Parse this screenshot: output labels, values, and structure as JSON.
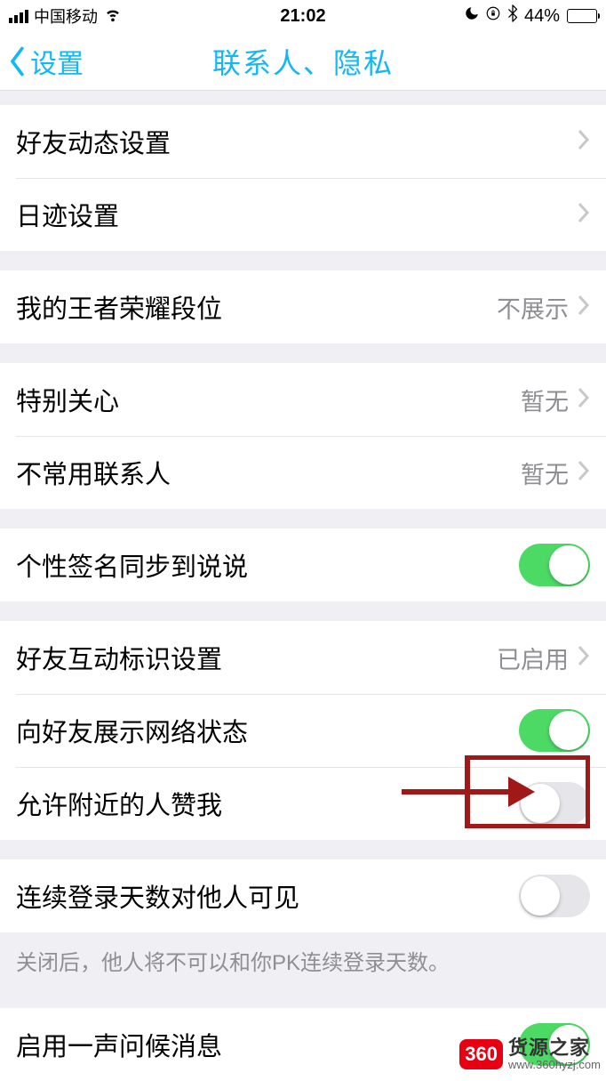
{
  "status": {
    "carrier": "中国移动",
    "time": "21:02",
    "battery_pct": "44%"
  },
  "nav": {
    "back_label": "设置",
    "title": "联系人、隐私"
  },
  "groups": [
    {
      "cells": [
        {
          "id": "friend-moments-settings",
          "label": "好友动态设置",
          "type": "chevron"
        },
        {
          "id": "riji-settings",
          "label": "日迹设置",
          "type": "chevron"
        }
      ]
    },
    {
      "cells": [
        {
          "id": "wangzhe-rank",
          "label": "我的王者荣耀段位",
          "value": "不展示",
          "type": "chevron"
        }
      ]
    },
    {
      "cells": [
        {
          "id": "special-care",
          "label": "特别关心",
          "value": "暂无",
          "type": "chevron"
        },
        {
          "id": "infrequent-contacts",
          "label": "不常用联系人",
          "value": "暂无",
          "type": "chevron"
        }
      ]
    },
    {
      "cells": [
        {
          "id": "signature-sync",
          "label": "个性签名同步到说说",
          "type": "switch",
          "on": true
        }
      ]
    },
    {
      "cells": [
        {
          "id": "friend-interaction-badge",
          "label": "好友互动标识设置",
          "value": "已启用",
          "type": "chevron"
        },
        {
          "id": "show-network-status",
          "label": "向好友展示网络状态",
          "type": "switch",
          "on": true
        },
        {
          "id": "nearby-like-me",
          "label": "允许附近的人赞我",
          "type": "switch",
          "on": false
        }
      ]
    },
    {
      "cells": [
        {
          "id": "login-days-visible",
          "label": "连续登录天数对他人可见",
          "type": "switch",
          "on": false
        }
      ],
      "footer": "关闭后，他人将不可以和你PK连续登录天数。"
    },
    {
      "cells": [
        {
          "id": "greeting-message",
          "label": "启用一声问候消息",
          "type": "switch",
          "on": true
        }
      ]
    }
  ],
  "watermark": {
    "badge": "360",
    "text": "货源之家",
    "url": "www.360hyzj.com"
  }
}
